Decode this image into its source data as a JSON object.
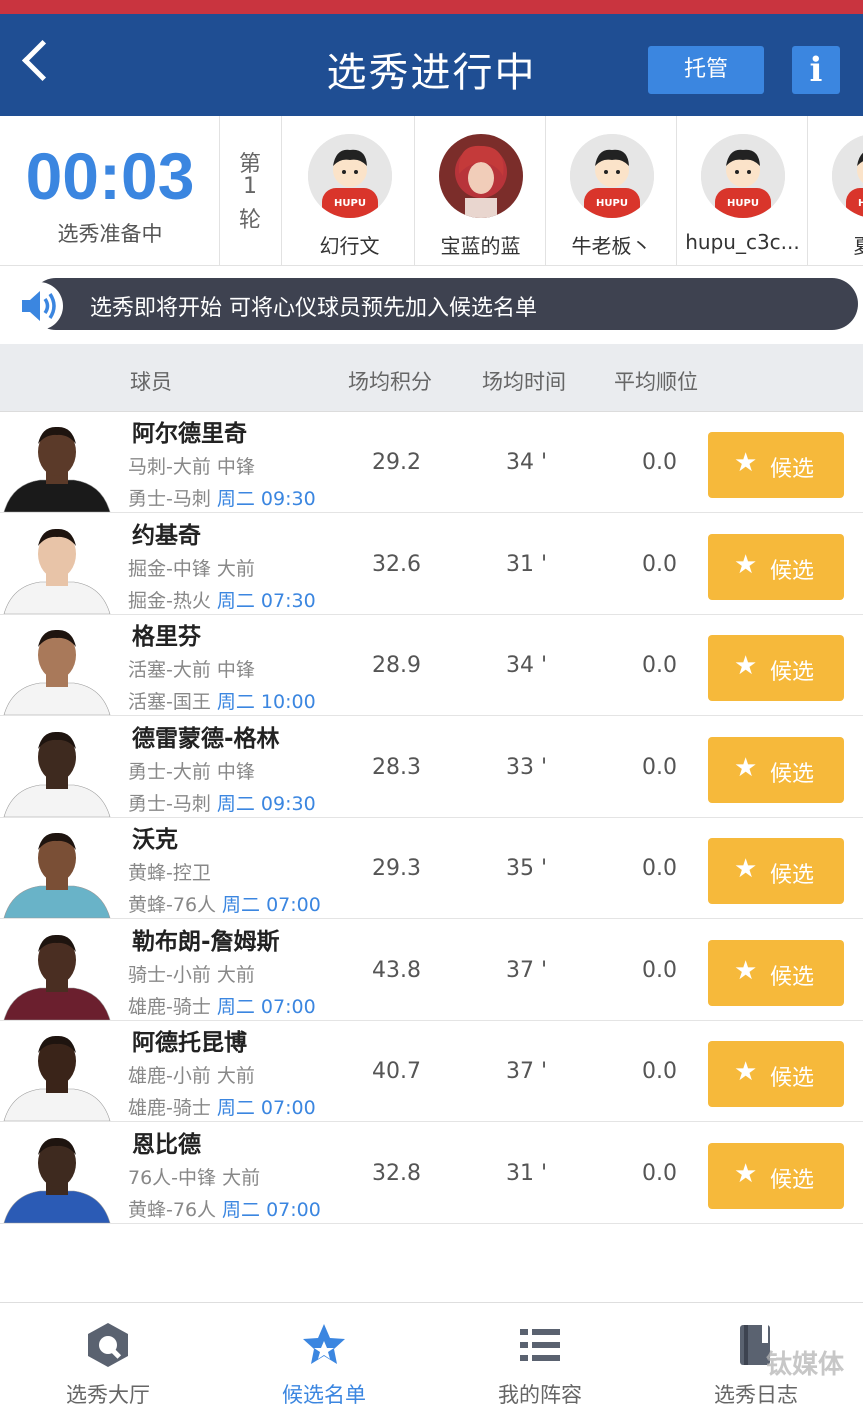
{
  "header": {
    "title": "选秀进行中",
    "auto_label": "托管",
    "info_label": "i"
  },
  "timer": {
    "value": "00:03",
    "status": "选秀准备中"
  },
  "round": {
    "line1": "第",
    "line2": "1",
    "line3": "轮"
  },
  "users": [
    {
      "name": "幻行文",
      "avatar": "hupu-default"
    },
    {
      "name": "宝蓝的蓝",
      "avatar": "photo"
    },
    {
      "name": "牛老板丶",
      "avatar": "hupu-default"
    },
    {
      "name": "hupu_c3c...",
      "avatar": "hupu-default"
    },
    {
      "name": "夏洛",
      "avatar": "hupu-default"
    }
  ],
  "notice": "选秀即将开始 可将心仪球员预先加入候选名单",
  "table": {
    "headers": {
      "player": "球员",
      "score": "场均积分",
      "time": "场均时间",
      "rank": "平均顺位"
    },
    "candidate_label": "候选",
    "rows": [
      {
        "name": "阿尔德里奇",
        "position": "马刺-大前 中锋",
        "game_teams": "勇士-马刺",
        "game_time": "周二 09:30",
        "score": "29.2",
        "minutes": "34 '",
        "rank": "0.0",
        "jersey": "#1a1a1a",
        "skin": "#5b3a29"
      },
      {
        "name": "约基奇",
        "position": "掘金-中锋 大前",
        "game_teams": "掘金-热火",
        "game_time": "周二 07:30",
        "score": "32.6",
        "minutes": "31 '",
        "rank": "0.0",
        "jersey": "#f4f4f4",
        "skin": "#e8c4a8"
      },
      {
        "name": "格里芬",
        "position": "活塞-大前 中锋",
        "game_teams": "活塞-国王",
        "game_time": "周二 10:00",
        "score": "28.9",
        "minutes": "34 '",
        "rank": "0.0",
        "jersey": "#f4f4f4",
        "skin": "#a9795a"
      },
      {
        "name": "德雷蒙德-格林",
        "position": "勇士-大前 中锋",
        "game_teams": "勇士-马刺",
        "game_time": "周二 09:30",
        "score": "28.3",
        "minutes": "33 '",
        "rank": "0.0",
        "jersey": "#f4f4f4",
        "skin": "#3e2a1f"
      },
      {
        "name": "沃克",
        "position": "黄蜂-控卫",
        "game_teams": "黄蜂-76人",
        "game_time": "周二 07:00",
        "score": "29.3",
        "minutes": "35 '",
        "rank": "0.0",
        "jersey": "#69b3c8",
        "skin": "#7a4f36"
      },
      {
        "name": "勒布朗-詹姆斯",
        "position": "骑士-小前 大前",
        "game_teams": "雄鹿-骑士",
        "game_time": "周二 07:00",
        "score": "43.8",
        "minutes": "37 '",
        "rank": "0.0",
        "jersey": "#6b1f2e",
        "skin": "#4a2e22"
      },
      {
        "name": "阿德托昆博",
        "position": "雄鹿-小前 大前",
        "game_teams": "雄鹿-骑士",
        "game_time": "周二 07:00",
        "score": "40.7",
        "minutes": "37 '",
        "rank": "0.0",
        "jersey": "#f4f4f4",
        "skin": "#3a2419"
      },
      {
        "name": "恩比德",
        "position": "76人-中锋 大前",
        "game_teams": "黄蜂-76人",
        "game_time": "周二 07:00",
        "score": "32.8",
        "minutes": "31 '",
        "rank": "0.0",
        "jersey": "#2b5bb5",
        "skin": "#3e2a1f"
      }
    ]
  },
  "tabs": [
    {
      "label": "选秀大厅",
      "icon": "hall-icon",
      "active": false
    },
    {
      "label": "候选名单",
      "icon": "star-icon",
      "active": true
    },
    {
      "label": "我的阵容",
      "icon": "list-icon",
      "active": false
    },
    {
      "label": "选秀日志",
      "icon": "log-icon",
      "active": false
    }
  ],
  "watermark": "钛媒体",
  "colors": {
    "header": "#1f4e93",
    "accent": "#3b86e0",
    "candidate": "#f6b93b",
    "top_stripe": "#c9343f"
  }
}
